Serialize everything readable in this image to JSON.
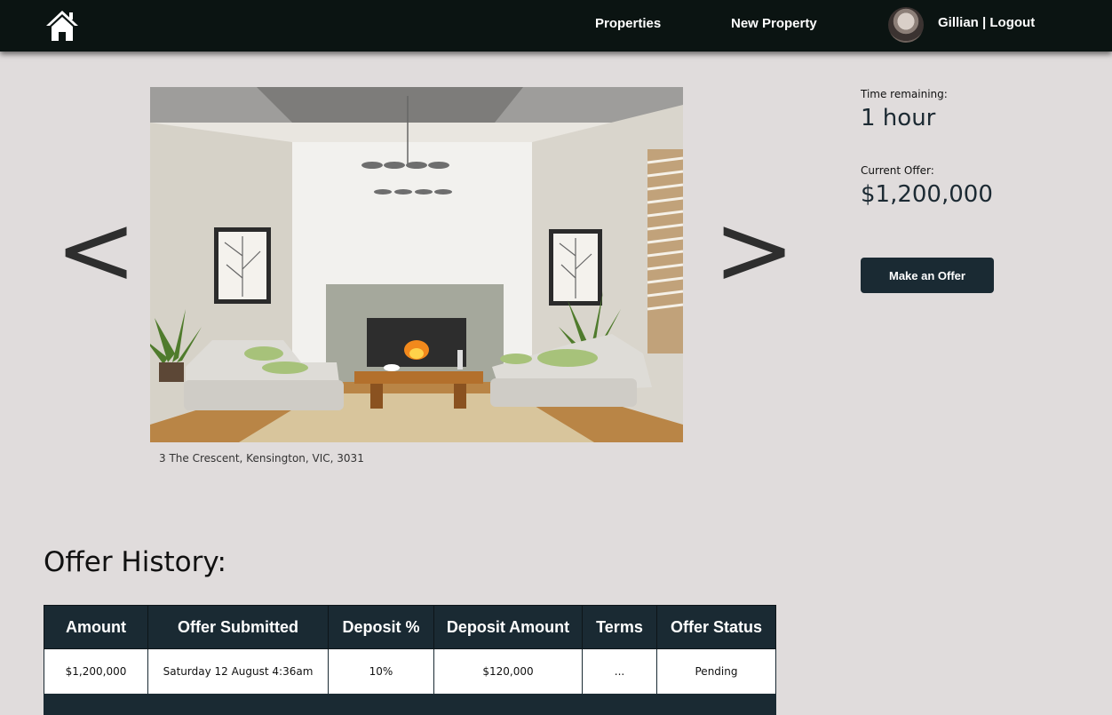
{
  "nav": {
    "home_icon": "home-icon",
    "links": [
      "Properties",
      "New Property"
    ],
    "user_name": "Gillian",
    "separator": "|",
    "logout": "Logout"
  },
  "gallery": {
    "prev": "<",
    "next": ">",
    "address": "3 The Crescent, Kensington, VIC, 3031"
  },
  "auction": {
    "time_label": "Time remaining:",
    "time_value": "1 hour",
    "offer_label": "Current Offer:",
    "offer_value": "$1,200,000",
    "make_offer": "Make an Offer"
  },
  "history": {
    "title": "Offer History:",
    "columns": [
      "Amount",
      "Offer Submitted",
      "Deposit %",
      "Deposit Amount",
      "Terms",
      "Offer Status"
    ],
    "rows": [
      [
        "$1,200,000",
        "Saturday 12 August 4:36am",
        "10%",
        "$120,000",
        "...",
        "Pending"
      ]
    ]
  },
  "colors": {
    "navbar": "#0b1412",
    "accent": "#1a2a33",
    "background": "#e0dcdc"
  }
}
